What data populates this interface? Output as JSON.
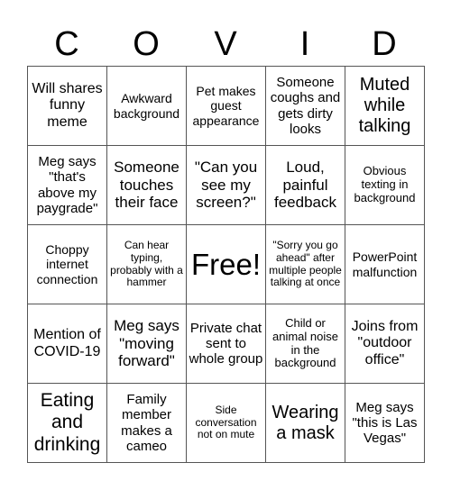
{
  "title_letters": [
    "C",
    "O",
    "V",
    "I",
    "D"
  ],
  "cells": [
    "Will shares funny meme",
    "Awkward background",
    "Pet makes guest appearance",
    "Someone coughs and gets dirty looks",
    "Muted while talking",
    "Meg says \"that's above my paygrade\"",
    "Someone touches their face",
    "\"Can you see my screen?\"",
    "Loud, painful feedback",
    "Obvious texting in background",
    "Choppy internet connection",
    "Can hear typing, probably with a hammer",
    "Free!",
    "\"Sorry you go ahead\" after multiple people talking at once",
    "PowerPoint malfunction",
    "Mention of COVID-19",
    "Meg says \"moving forward\"",
    "Private chat sent to whole group",
    "Child or animal noise in the background",
    "Joins from \"outdoor office\"",
    "Eating and drinking",
    "Family member makes a cameo",
    "Side conversation not on mute",
    "Wearing a mask",
    "Meg says \"this is Las Vegas\""
  ]
}
